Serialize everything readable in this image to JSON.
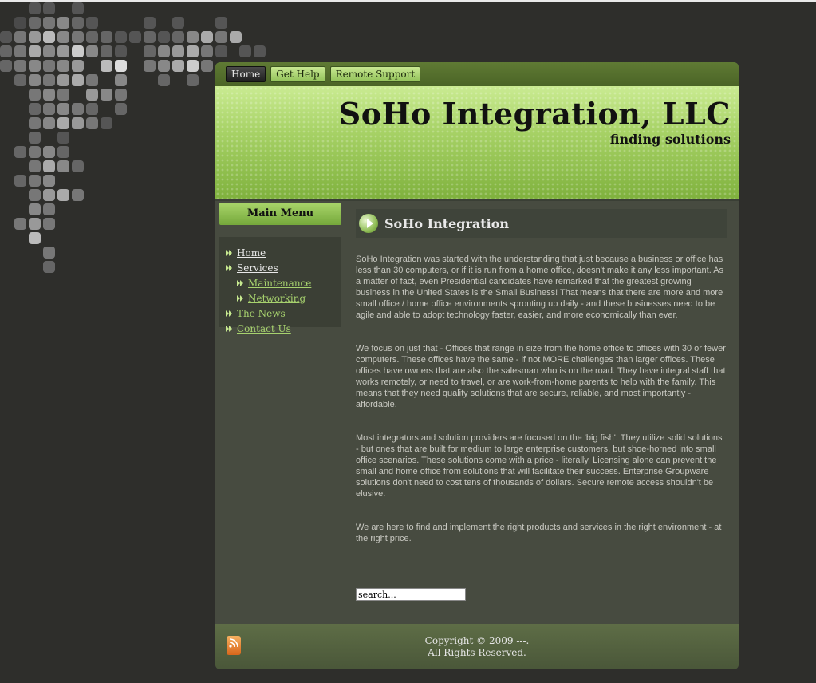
{
  "topnav": {
    "tabs": [
      {
        "label": "Home",
        "active": true
      },
      {
        "label": "Get Help",
        "active": false
      },
      {
        "label": "Remote Support",
        "active": false
      }
    ]
  },
  "banner": {
    "title": "SoHo Integration, LLC",
    "tagline": "finding solutions"
  },
  "sidebar": {
    "menu_title": "Main Menu",
    "items": [
      {
        "label": "Home"
      },
      {
        "label": "Services"
      },
      {
        "label": "Maintenance"
      },
      {
        "label": "Networking"
      },
      {
        "label": "The News"
      },
      {
        "label": "Contact Us"
      }
    ]
  },
  "content": {
    "title": "SoHo Integration",
    "paragraphs": [
      "SoHo Integration was started with the understanding that just because a business or office has less than 30 computers, or if it is run from a home office, doesn't make it any less important. As a matter of fact, even Presidential candidates have remarked that the greatest growing business in the United States is the Small Business! That means that there are more and more small office / home office environments sprouting up daily - and these businesses need to be agile and able to adopt technology faster, easier, and more economically than ever.",
      "We focus on just that - Offices that range in size from the home office to offices with 30 or fewer computers. These offices have the same - if not MORE challenges than larger offices. These offices have owners that are also the salesman who is on the road. They have integral staff that works remotely, or need to travel, or are work-from-home parents to help with the family. This means that they need quality solutions that are secure, reliable, and most importantly - affordable.",
      "Most integrators and solution providers are focused on the 'big fish'. They utilize solid solutions - but ones that are built for medium to large enterprise customers, but shoe-horned into small office scenarios. These solutions come with a price - literally. Licensing alone can prevent the small and home office from solutions that will facilitate their success. Enterprise Groupware solutions don't need to cost tens of thousands of dollars. Secure remote access shouldn't be elusive.",
      "We are here to find and implement the right products and services in the right environment - at the right price."
    ]
  },
  "search": {
    "value": "search..."
  },
  "footer": {
    "copyright_line1": "Copyright © 2009 ---.",
    "copyright_line2": "All Rights Reserved.",
    "rss_icon": "rss-feed-icon"
  },
  "colors": {
    "background": "#2e2e2b",
    "panel": "#474b40",
    "accent_green": "#a7d266",
    "link_green": "#a7d26e"
  }
}
